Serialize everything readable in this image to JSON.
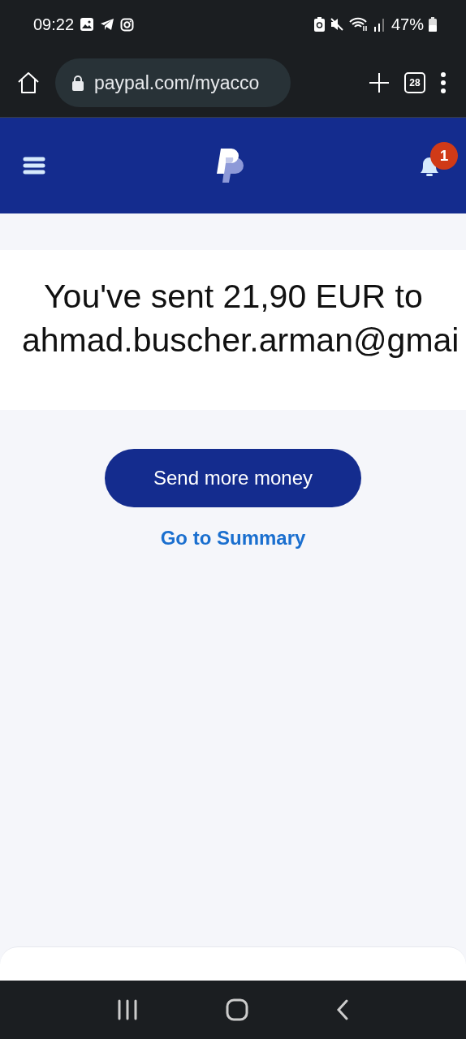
{
  "status_bar": {
    "time": "09:22",
    "battery": "47%"
  },
  "browser": {
    "url": "paypal.com/myacco",
    "tab_count": "28"
  },
  "header": {
    "notification_count": "1"
  },
  "confirmation": {
    "message": "You've sent 21,90 EUR to ahmad.buscher.arman@gmai"
  },
  "actions": [
    {
      "label": "Send more money",
      "kind": "primary"
    },
    {
      "label": "Go to Summary",
      "kind": "link"
    }
  ]
}
